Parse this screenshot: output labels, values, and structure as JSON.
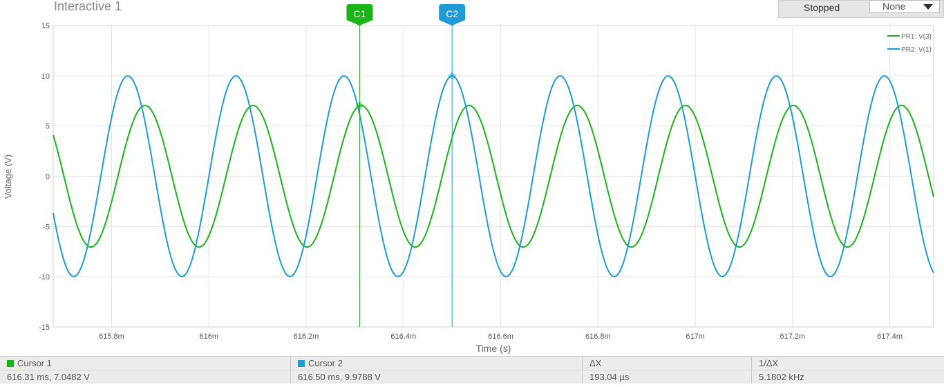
{
  "window": {
    "title": "Interactive 1",
    "status": "Stopped",
    "dropdown_value": "None"
  },
  "colors": {
    "green": "#18b418",
    "blue": "#1e9ad6",
    "grid": "#e4e4e4"
  },
  "chart_data": {
    "type": "line",
    "xlabel": "Time (s)",
    "ylabel": "Voltage (V)",
    "xlim": [
      615.68,
      617.49
    ],
    "ylim": [
      -15,
      15
    ],
    "x_ticks": [
      615.8,
      616.0,
      616.2,
      616.4,
      616.6,
      616.8,
      617.0,
      617.2,
      617.4
    ],
    "x_tick_labels": [
      "615.8m",
      "616m",
      "616.2m",
      "616.4m",
      "616.6m",
      "616.8m",
      "617m",
      "617.2m",
      "617.4m"
    ],
    "y_ticks": [
      -15,
      -10,
      -5,
      0,
      5,
      10,
      15
    ],
    "y_tick_labels": [
      "-15",
      "-10",
      "-5",
      "0",
      "5",
      "10",
      "15"
    ],
    "grid": true,
    "legend_position": "top-right",
    "series": [
      {
        "name": "PR1: V(3)",
        "color": "#18b418",
        "amplitude": 7.05,
        "period_ms": 0.2222,
        "peak_at_ms": 616.313
      },
      {
        "name": "PR2: V(1)",
        "color": "#1e9ad6",
        "amplitude": 9.98,
        "period_ms": 0.2222,
        "peak_at_ms": 616.5
      }
    ],
    "cursors": [
      {
        "label": "C1",
        "x_ms": 616.31,
        "y": 7.0482,
        "color": "#18b418"
      },
      {
        "label": "C2",
        "x_ms": 616.5,
        "y": 9.9788,
        "color": "#1e9ad6"
      }
    ]
  },
  "footer": {
    "headers": [
      "Cursor 1",
      "Cursor 2",
      "ΔX",
      "1/ΔX"
    ],
    "values": [
      "616.31 ms, 7.0482 V",
      "616.50 ms, 9.9788 V",
      "193.04 µs",
      "5.1802 kHz"
    ]
  }
}
